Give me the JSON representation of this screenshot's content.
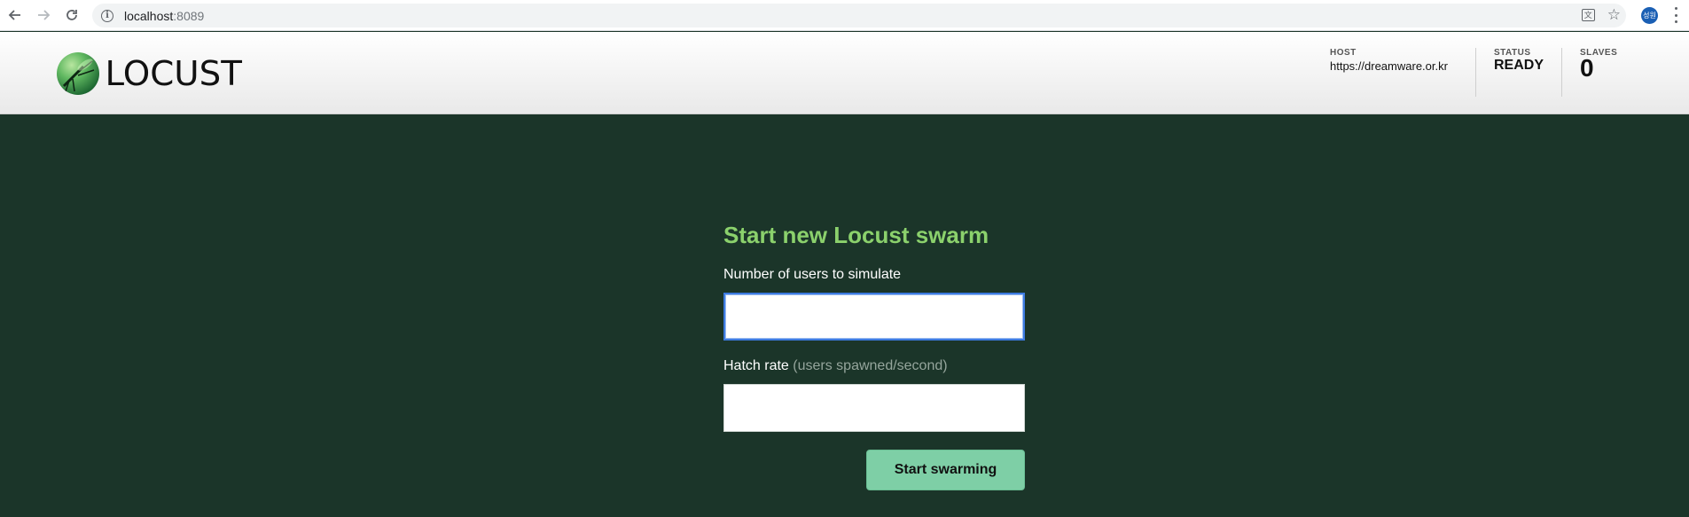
{
  "browser": {
    "url_host": "localhost",
    "url_port": ":8089",
    "profile_initials": "성원",
    "translate_glyph": "文"
  },
  "header": {
    "logo_text": "LOCUST",
    "host_label": "HOST",
    "host_value": "https://dreamware.or.kr",
    "status_label": "STATUS",
    "status_value": "READY",
    "slaves_label": "SLAVES",
    "slaves_value": "0"
  },
  "form": {
    "title": "Start new Locust swarm",
    "users_label": "Number of users to simulate",
    "users_value": "",
    "hatch_label": "Hatch rate",
    "hatch_hint": "(users spawned/second)",
    "hatch_value": "",
    "submit_label": "Start swarming"
  },
  "colors": {
    "page_bg": "#1b3529",
    "title": "#8bd16c",
    "submit_bg": "#7ecfa6",
    "focus_ring": "#3d7be0"
  }
}
